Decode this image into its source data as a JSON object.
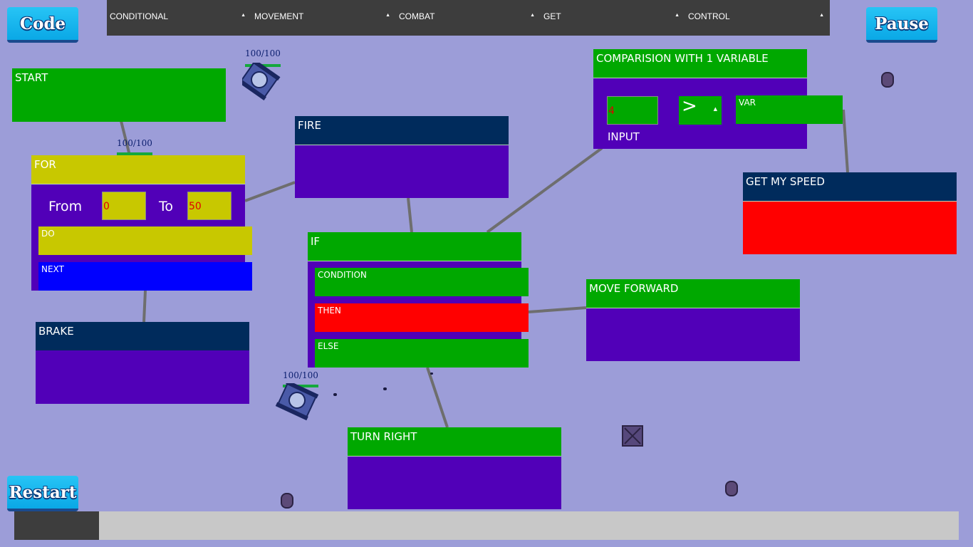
{
  "buttons": {
    "code": "Code",
    "pause": "Pause",
    "restart": "Restart"
  },
  "menu": [
    {
      "label": "CONDITIONAL"
    },
    {
      "label": "MOVEMENT"
    },
    {
      "label": "COMBAT"
    },
    {
      "label": "GET"
    },
    {
      "label": "CONTROL"
    }
  ],
  "blocks": {
    "start": {
      "title": "START"
    },
    "for": {
      "title": "FOR",
      "from_label": "From",
      "from_value": "0",
      "to_label": "To",
      "to_value": "50",
      "do_label": "DO",
      "next_label": "NEXT"
    },
    "brake": {
      "title": "BRAKE"
    },
    "fire": {
      "title": "FIRE"
    },
    "if": {
      "title": "IF",
      "condition_label": "CONDITION",
      "then_label": "THEN",
      "else_label": "ELSE"
    },
    "turn_right": {
      "title": "TURN RIGHT"
    },
    "move_forward": {
      "title": "MOVE FORWARD"
    },
    "comparison": {
      "title": "COMPARISION WITH 1 VARIABLE",
      "input_value": "4",
      "operator": ">",
      "var_label": "VAR",
      "input_label": "INPUT"
    },
    "get_speed": {
      "title": "GET MY SPEED"
    }
  },
  "tanks": [
    {
      "health": "100/100"
    },
    {
      "health": "100/100"
    },
    {
      "health": "100/100"
    }
  ],
  "progress": {
    "fraction": 0.09
  },
  "colors": {
    "background": "#9c9dd8",
    "block_body": "#5100b8",
    "green": "#00a800",
    "navy": "#002b5c",
    "olive": "#c8c800",
    "red": "#ff0000",
    "blue": "#0000ff"
  }
}
